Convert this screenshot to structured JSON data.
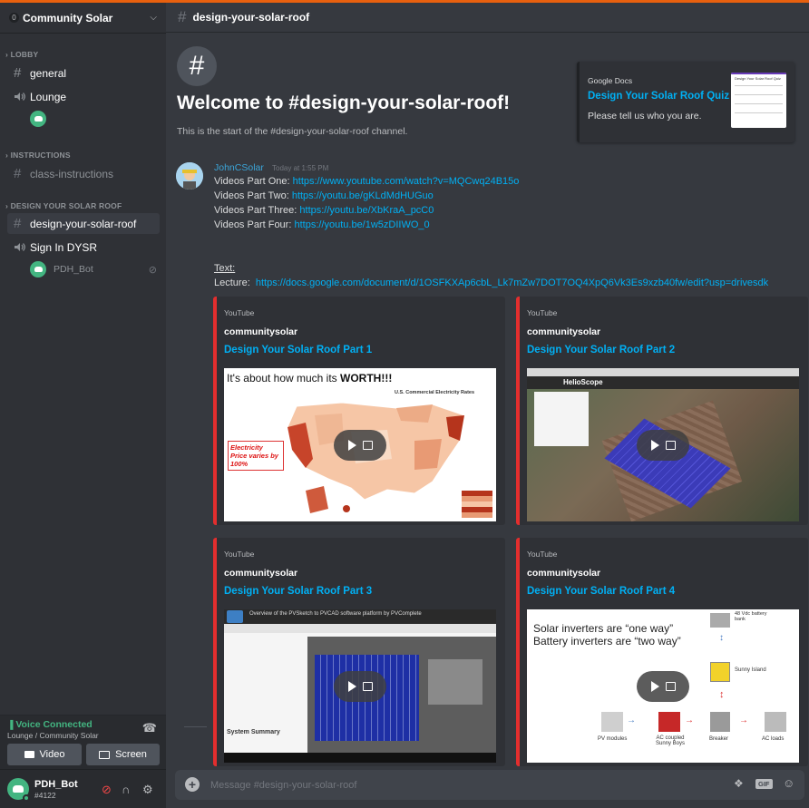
{
  "server": {
    "name": "Community Solar",
    "badge": "0"
  },
  "categories": {
    "lobby": "LOBBY",
    "instructions": "INSTRUCTIONS",
    "dysr": "DESIGN YOUR SOLAR ROOF"
  },
  "channels": {
    "general": "general",
    "lounge": "Lounge",
    "class_instructions": "class-instructions",
    "design": "design-your-solar-roof",
    "signin": "Sign In DYSR",
    "bot_user": "PDH_Bot"
  },
  "voice": {
    "status": "Voice Connected",
    "location": "Lounge / Community Solar",
    "video_label": "Video",
    "screen_label": "Screen"
  },
  "user": {
    "name": "PDH_Bot",
    "tag": "#4122"
  },
  "header": {
    "channel": "design-your-solar-roof"
  },
  "welcome": {
    "title": "Welcome to #design-your-solar-roof!",
    "subtitle": "This is the start of the #design-your-solar-roof channel."
  },
  "gdoc": {
    "provider": "Google Docs",
    "title": "Design Your Solar Roof Quiz",
    "desc": "Please tell us who you are.",
    "thumb_title": "Design Your Solar Roof Quiz"
  },
  "message": {
    "author": "JohnCSolar",
    "time": "Today at 1:55 PM",
    "lines": [
      {
        "label": "Videos Part One:",
        "url": "https://www.youtube.com/watch?v=MQCwq24B15o"
      },
      {
        "label": "Videos Part Two:",
        "url": "https://youtu.be/gKLdMdHUGuo"
      },
      {
        "label": "Videos Part Three:",
        "url": "https://youtu.be/XbKraA_pcC0"
      },
      {
        "label": "Videos Part Four:",
        "url": "https://youtu.be/1w5zDIIWO_0"
      }
    ],
    "text_label": "Text:",
    "lecture_label": "Lecture:",
    "lecture_url": "https://docs.google.com/document/d/1OSFKXAp6cbL_Lk7mZw7DOT7OQ4XpQ6Vk3Es9xzb40fw/edit?usp=drivesdk"
  },
  "embeds": [
    {
      "provider": "YouTube",
      "author": "communitysolar",
      "title": "Design Your Solar Roof Part 1",
      "thumb_heading": "It's about how much its ",
      "thumb_heading_bold": "WORTH!!!",
      "thumb_note": "Electricity Price varies by 100%",
      "thumb_map_title": "U.S. Commercial Electricity Rates"
    },
    {
      "provider": "YouTube",
      "author": "communitysolar",
      "title": "Design Your Solar Roof Part 2",
      "thumb_logo": "HelioScope"
    },
    {
      "provider": "YouTube",
      "author": "communitysolar",
      "title": "Design Your Solar Roof Part 3",
      "thumb_caption": "Overview of the PVSketch to PVCAD software platform by PVComplete",
      "thumb_summary": "System Summary"
    },
    {
      "provider": "YouTube",
      "author": "communitysolar",
      "title": "Design Your Solar Roof Part 4",
      "thumb_line1": "Solar inverters are “one way”",
      "thumb_line2": "Battery inverters are “two way”",
      "battery": "48 Vdc battery bank",
      "island": "Sunny Island",
      "pv": "PV modules",
      "ac_coupled": "AC coupled Sunny Boys",
      "breaker": "Breaker",
      "ac_loads": "AC loads"
    }
  ],
  "composer": {
    "placeholder": "Message #design-your-solar-roof",
    "gif": "GIF"
  },
  "colors": {
    "accent_top": "#e8600e",
    "link": "#00b0f4",
    "embed_border": "#e32e2e",
    "online": "#43b581"
  }
}
